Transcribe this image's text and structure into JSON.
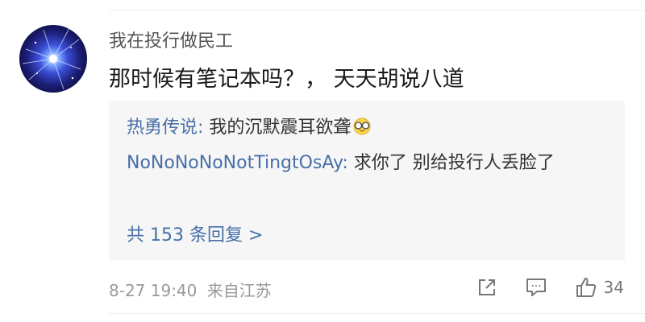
{
  "comment": {
    "username": "我在投行做民工",
    "text": "那时候有笔记本吗？，  天天胡说八道",
    "avatar_icon": "galaxy-avatar"
  },
  "replies": [
    {
      "author": "热勇传说",
      "separator": ": ",
      "text": "我的沉默震耳欲聋",
      "emoji": "face-with-glasses-emoji"
    },
    {
      "author": "NoNoNoNoNotTingtOsAy",
      "separator": ": ",
      "text": "求你了 别给投行人丢脸了"
    }
  ],
  "more_replies": "共 153 条回复 >",
  "meta": {
    "timestamp": "8-27 19:40",
    "location": "来自江苏"
  },
  "actions": {
    "share_icon": "share-icon",
    "comment_icon": "comment-icon",
    "like_icon": "thumbs-up-icon",
    "like_count": "34"
  },
  "colors": {
    "link_blue": "#476fa8",
    "reply_bg": "#f6f6f6",
    "meta_gray": "#999999"
  }
}
